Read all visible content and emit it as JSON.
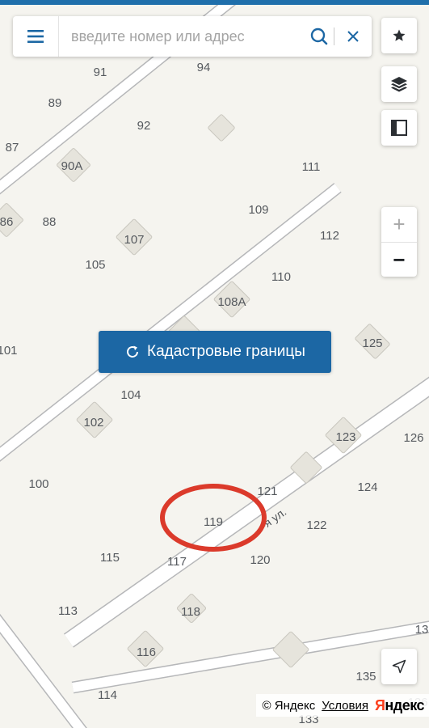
{
  "search": {
    "placeholder": "введите номер или адрес"
  },
  "map": {
    "house_numbers": [
      "91",
      "94",
      "89",
      "92",
      "87",
      "90А",
      "111",
      "86",
      "88",
      "109",
      "107",
      "112",
      "105",
      "110",
      "108А",
      "101",
      "125",
      "104",
      "102",
      "123",
      "126",
      "100",
      "121",
      "124",
      "119",
      "122",
      "115",
      "117",
      "120",
      "113",
      "118",
      "13",
      "116",
      "135",
      "114",
      "133",
      "126"
    ],
    "street_label": "-я ул.",
    "highlight_color": "#db3a2b"
  },
  "buttons": {
    "cadastre_label": "Кадастровые границы"
  },
  "zoom": {
    "in_label": "+",
    "out_label": "−"
  },
  "footer": {
    "copyright": "© Яндекс",
    "terms_link": "Условия",
    "brand_first": "Я",
    "brand_rest": "ндекс"
  },
  "icons": {
    "menu": "hamburger-menu-icon",
    "search": "search-icon",
    "clear": "close-icon",
    "bookmark": "star-icon",
    "layers": "layers-icon",
    "ruler": "ruler-icon",
    "refresh": "refresh-icon",
    "locate": "navigation-arrow-icon"
  },
  "colors": {
    "accent": "#1c67a4",
    "map_background": "#f5f4ef",
    "house_fill": "#e6e4dc",
    "road": "#ffffff"
  }
}
